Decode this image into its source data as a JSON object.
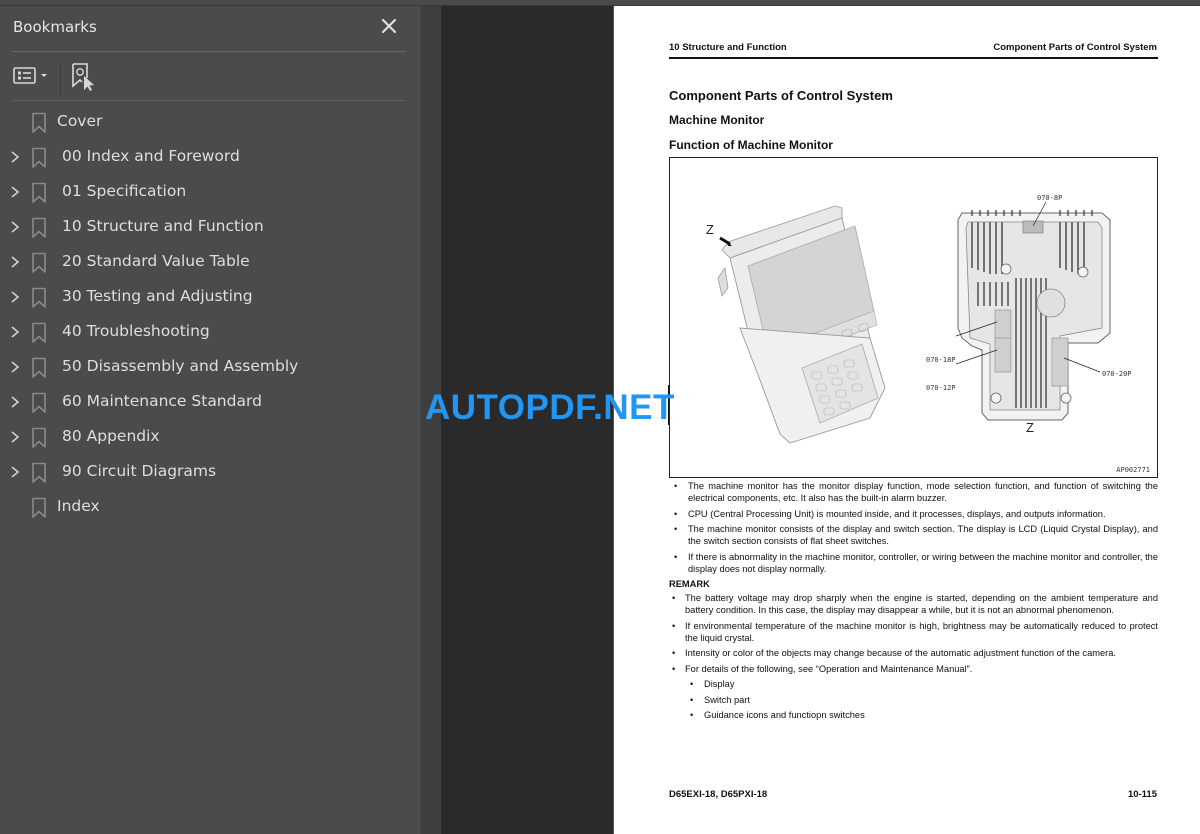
{
  "sidebar": {
    "title": "Bookmarks",
    "close_icon": "close-icon",
    "toolbar": {
      "options_icon": "list-options-icon",
      "find_icon": "find-current-bookmark-icon"
    },
    "items": [
      {
        "label": "Cover",
        "expandable": false
      },
      {
        "label": "00 Index and Foreword",
        "expandable": true
      },
      {
        "label": "01 Specification",
        "expandable": true
      },
      {
        "label": "10 Structure and Function",
        "expandable": true
      },
      {
        "label": "20 Standard Value Table",
        "expandable": true
      },
      {
        "label": "30 Testing and Adjusting",
        "expandable": true
      },
      {
        "label": "40 Troubleshooting",
        "expandable": true
      },
      {
        "label": "50 Disassembly and Assembly",
        "expandable": true
      },
      {
        "label": "60 Maintenance Standard",
        "expandable": true
      },
      {
        "label": "80 Appendix",
        "expandable": true
      },
      {
        "label": "90 Circuit Diagrams",
        "expandable": true
      },
      {
        "label": "Index",
        "expandable": false
      }
    ]
  },
  "page": {
    "header_left": "10 Structure and Function",
    "header_right": "Component Parts of Control System",
    "title": "Component Parts of Control System",
    "subtitle": "Machine Monitor",
    "section": "Function of Machine Monitor",
    "figure": {
      "view_label": "Z",
      "view_label_bottom": "Z",
      "connectors": [
        "070-8P",
        "070-18P",
        "070-12P",
        "070-20P"
      ],
      "code": "AP002771"
    },
    "bullets": [
      "The machine monitor has the monitor display function, mode selection function, and function of switching the electrical components, etc. It also has the built-in alarm buzzer.",
      "CPU (Central Processing Unit) is mounted inside, and it processes, displays, and outputs information.",
      "The machine monitor consists of the display and switch section. The display is LCD (Liquid Crystal Display), and the switch section consists of flat sheet switches.",
      "If there is abnormality in the machine monitor, controller, or wiring between the machine monitor and controller, the display does not display normally."
    ],
    "remark_title": "REMARK",
    "remarks": [
      "The battery voltage may drop sharply when the engine is started, depending on the ambient temperature and battery condition. In this case, the display may disappear a while, but it is not an abnormal phenomenon.",
      "If environmental temperature of the machine monitor is high, brightness may be automatically reduced to protect the liquid crystal.",
      "Intensity or color of the objects may change because of the automatic adjustment function of the camera.",
      "For details of the following, see “Operation and Maintenance Manual”."
    ],
    "sub_items": [
      "Display",
      "Switch part",
      "Guidance icons and functiopn switches"
    ],
    "footer_left": "D65EXI-18, D65PXI-18",
    "footer_right": "10-115"
  },
  "watermark": "AUTOPDF.NET",
  "colors": {
    "sidebar_bg": "#4b4b4b",
    "viewer_bg": "#2a2a2a",
    "watermark": "#2196f3"
  }
}
